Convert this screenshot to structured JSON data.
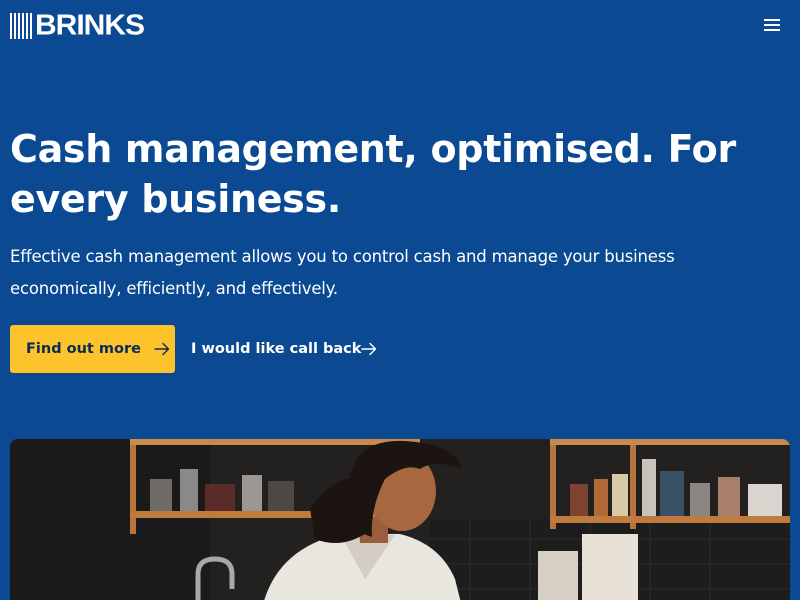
{
  "brand": {
    "logo_text": "BRINKS",
    "logo_icon": "brinks-stripes-logo"
  },
  "header": {
    "menu_icon": "hamburger-menu-icon"
  },
  "hero": {
    "title": "Cash management, optimised. For every business.",
    "subtitle": "Effective cash management allows you to control cash and manage your business economically, efficiently, and effectively.",
    "primary_cta": "Find out more",
    "secondary_cta": "I would like call back",
    "cta_icon": "arrow-right-icon",
    "image_icon": "woman-in-kitchen-photo"
  },
  "colors": {
    "background": "#0b4a93",
    "accent": "#fcc32c",
    "text": "#ffffff",
    "button_text": "#0b2a55"
  }
}
